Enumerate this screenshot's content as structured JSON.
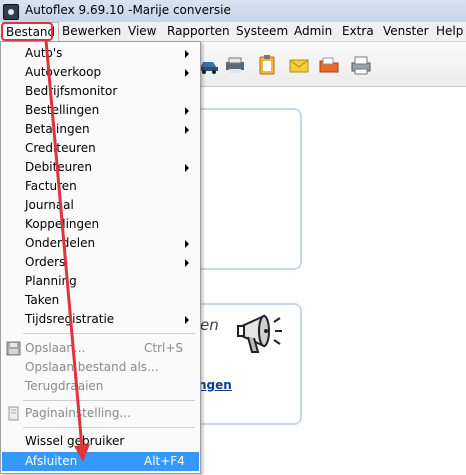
{
  "window": {
    "title": "Autoflex 9.69.10 -Marije conversie"
  },
  "menubar": {
    "items": [
      "Bestand",
      "Bewerken",
      "View",
      "Rapporten",
      "Systeem",
      "Admin",
      "Extra",
      "Venster",
      "Help"
    ]
  },
  "toolbar": {
    "icons": [
      "car-icon",
      "printer-stack-icon",
      "clipboard-icon",
      "envelope-icon",
      "folder-icon",
      "printer-icon"
    ]
  },
  "content": {
    "partial_heading": "en",
    "partial_link": "ngen"
  },
  "dropdown": {
    "items": [
      {
        "label": "Auto's",
        "submenu": true
      },
      {
        "label": "Autoverkoop",
        "submenu": true
      },
      {
        "label": "Bedrijfsmonitor",
        "submenu": false
      },
      {
        "label": "Bestellingen",
        "submenu": true
      },
      {
        "label": "Betalingen",
        "submenu": true
      },
      {
        "label": "Crediteuren",
        "submenu": false
      },
      {
        "label": "Debiteuren",
        "submenu": true
      },
      {
        "label": "Facturen",
        "submenu": false
      },
      {
        "label": "Journaal",
        "submenu": false
      },
      {
        "label": "Koppelingen",
        "submenu": false
      },
      {
        "label": "Onderdelen",
        "submenu": true
      },
      {
        "label": "Orders",
        "submenu": true
      },
      {
        "label": "Planning",
        "submenu": false
      },
      {
        "label": "Taken",
        "submenu": false
      },
      {
        "label": "Tijdsregistratie",
        "submenu": true
      }
    ],
    "file_items": [
      {
        "label": "Opslaan...",
        "shortcut": "Ctrl+S",
        "disabled": true
      },
      {
        "label": "Opslaan bestand als...",
        "shortcut": "",
        "disabled": true
      },
      {
        "label": "Terugdraaien",
        "shortcut": "",
        "disabled": true
      }
    ],
    "page_setup": {
      "label": "Paginainstelling...",
      "disabled": true
    },
    "switch_user": {
      "label": "Wissel gebruiker"
    },
    "exit": {
      "label": "Afsluiten",
      "shortcut": "Alt+F4"
    }
  },
  "colors": {
    "annotation_red": "#e0343c",
    "highlight_blue": "#3399ff"
  }
}
